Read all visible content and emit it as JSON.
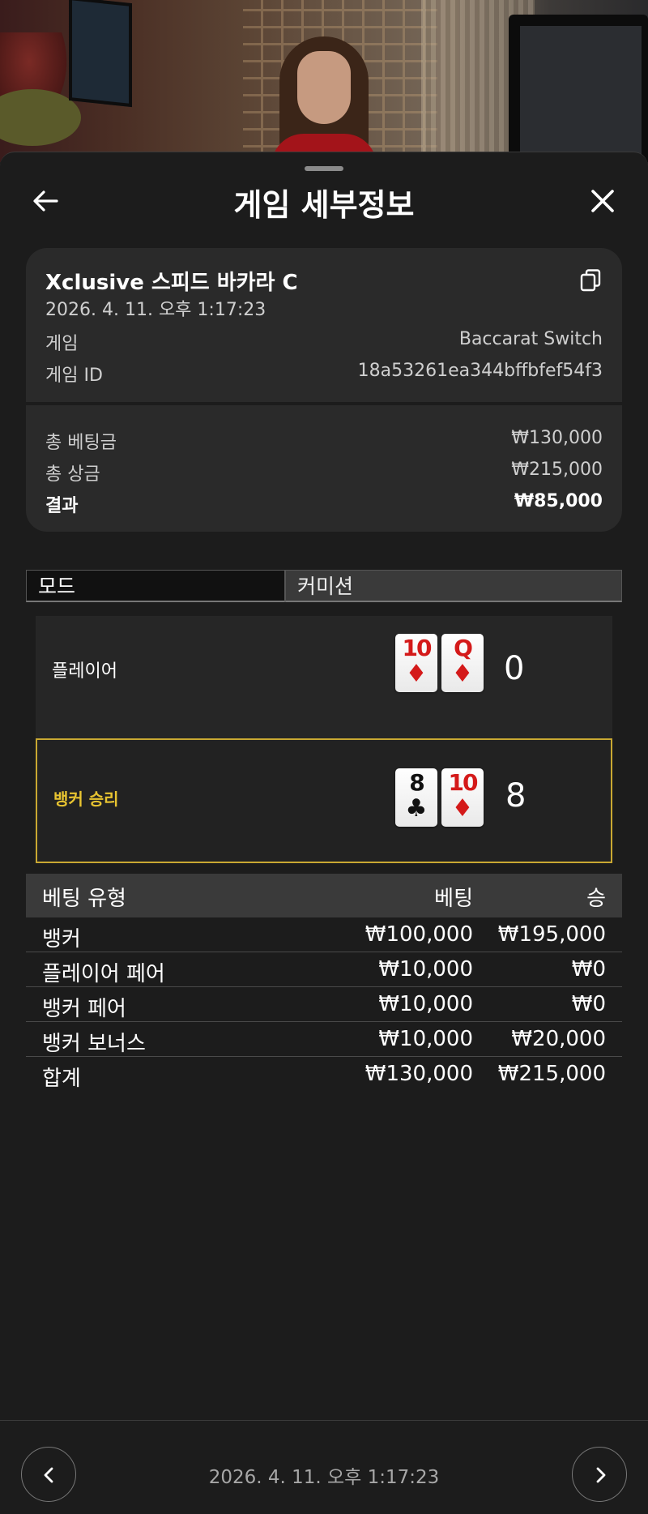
{
  "header": {
    "title": "게임 세부정보",
    "back_icon": "arrow-left-icon",
    "close_icon": "close-icon"
  },
  "summary": {
    "game_name": "Xclusive 스피드 바카라 C",
    "game_time": "2026. 4. 11. 오후 1:17:23",
    "copy_icon": "copy-icon",
    "rows": [
      {
        "label": "게임",
        "value": "Baccarat Switch"
      },
      {
        "label": "게임 ID",
        "value": "18a53261ea344bffbfef54f3"
      }
    ],
    "totals": [
      {
        "label": "총 베팅금",
        "value": "₩130,000"
      },
      {
        "label": "총 상금",
        "value": "₩215,000"
      },
      {
        "label": "결과",
        "value": "₩85,000"
      }
    ]
  },
  "tabs": {
    "mode": "모드",
    "commission": "커미션"
  },
  "hands": {
    "player": {
      "label": "플레이어",
      "cards": [
        {
          "rank": "10",
          "suit": "♦",
          "color": "#d41a1a"
        },
        {
          "rank": "Q",
          "suit": "♦",
          "color": "#d41a1a"
        }
      ],
      "score": "0"
    },
    "banker": {
      "label": "뱅커 승리",
      "cards": [
        {
          "rank": "8",
          "suit": "♣",
          "color": "#111111"
        },
        {
          "rank": "10",
          "suit": "♦",
          "color": "#d41a1a"
        }
      ],
      "score": "8"
    }
  },
  "bet_table": {
    "headers": {
      "type": "베팅 유형",
      "bet": "베팅",
      "win": "승"
    },
    "rows": [
      {
        "type": "뱅커",
        "bet": "₩100,000",
        "win": "₩195,000"
      },
      {
        "type": "플레이어 페어",
        "bet": "₩10,000",
        "win": "₩0"
      },
      {
        "type": "뱅커 페어",
        "bet": "₩10,000",
        "win": "₩0"
      },
      {
        "type": "뱅커 보너스",
        "bet": "₩10,000",
        "win": "₩20,000"
      }
    ],
    "total": {
      "type": "합계",
      "bet": "₩130,000",
      "win": "₩215,000"
    }
  },
  "footer": {
    "timestamp": "2026. 4. 11. 오후 1:17:23",
    "prev_icon": "chevron-left-icon",
    "next_icon": "chevron-right-icon"
  },
  "colors": {
    "sheet_bg": "#1c1c1c",
    "card_bg": "#2a2a2a",
    "winner_accent": "#e8c431",
    "red_suit": "#d41a1a"
  }
}
